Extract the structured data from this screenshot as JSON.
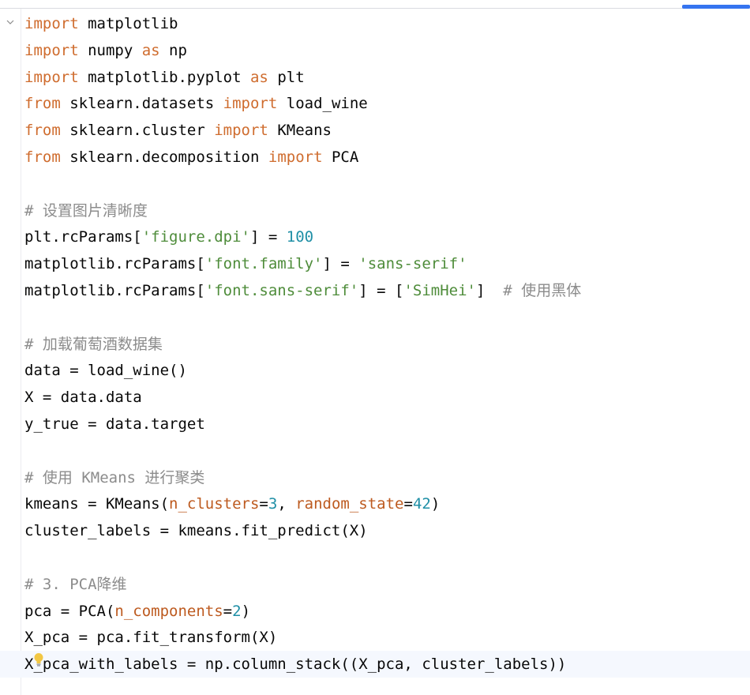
{
  "editor": {
    "lines": [
      [
        {
          "t": "kw",
          "v": "import"
        },
        {
          "t": "id",
          "v": " matplotlib"
        }
      ],
      [
        {
          "t": "kw",
          "v": "import"
        },
        {
          "t": "id",
          "v": " numpy "
        },
        {
          "t": "kw",
          "v": "as"
        },
        {
          "t": "id",
          "v": " np"
        }
      ],
      [
        {
          "t": "kw",
          "v": "import"
        },
        {
          "t": "id",
          "v": " matplotlib.pyplot "
        },
        {
          "t": "kw",
          "v": "as"
        },
        {
          "t": "id",
          "v": " plt"
        }
      ],
      [
        {
          "t": "kw",
          "v": "from"
        },
        {
          "t": "id",
          "v": " sklearn.datasets "
        },
        {
          "t": "kw",
          "v": "import"
        },
        {
          "t": "id",
          "v": " load_wine"
        }
      ],
      [
        {
          "t": "kw",
          "v": "from"
        },
        {
          "t": "id",
          "v": " sklearn.cluster "
        },
        {
          "t": "kw",
          "v": "import"
        },
        {
          "t": "id",
          "v": " KMeans"
        }
      ],
      [
        {
          "t": "kw",
          "v": "from"
        },
        {
          "t": "id",
          "v": " sklearn.decomposition "
        },
        {
          "t": "kw",
          "v": "import"
        },
        {
          "t": "id",
          "v": " PCA"
        }
      ],
      [],
      [
        {
          "t": "cmt",
          "v": "# "
        },
        {
          "t": "cmt-cjk",
          "v": "设置图片清晰度"
        }
      ],
      [
        {
          "t": "id",
          "v": "plt.rcParams["
        },
        {
          "t": "str",
          "v": "'figure.dpi'"
        },
        {
          "t": "id",
          "v": "] = "
        },
        {
          "t": "num",
          "v": "100"
        }
      ],
      [
        {
          "t": "id",
          "v": "matplotlib.rcParams["
        },
        {
          "t": "str",
          "v": "'font.family'"
        },
        {
          "t": "id",
          "v": "] = "
        },
        {
          "t": "str",
          "v": "'sans-serif'"
        }
      ],
      [
        {
          "t": "id",
          "v": "matplotlib.rcParams["
        },
        {
          "t": "str",
          "v": "'font.sans-serif'"
        },
        {
          "t": "id",
          "v": "] = ["
        },
        {
          "t": "str",
          "v": "'SimHei'"
        },
        {
          "t": "id",
          "v": "]  "
        },
        {
          "t": "cmt",
          "v": "# "
        },
        {
          "t": "cmt-cjk",
          "v": "使用黑体"
        }
      ],
      [],
      [
        {
          "t": "cmt",
          "v": "# "
        },
        {
          "t": "cmt-cjk",
          "v": "加载葡萄酒数据集"
        }
      ],
      [
        {
          "t": "id",
          "v": "data = load_wine()"
        }
      ],
      [
        {
          "t": "id",
          "v": "X = data.data"
        }
      ],
      [
        {
          "t": "id",
          "v": "y_true = data.target"
        }
      ],
      [],
      [
        {
          "t": "cmt",
          "v": "# "
        },
        {
          "t": "cmt-cjk",
          "v": "使用"
        },
        {
          "t": "cmt",
          "v": " KMeans "
        },
        {
          "t": "cmt-cjk",
          "v": "进行聚类"
        }
      ],
      [
        {
          "t": "id",
          "v": "kmeans = KMeans("
        },
        {
          "t": "param",
          "v": "n_clusters"
        },
        {
          "t": "id",
          "v": "="
        },
        {
          "t": "num",
          "v": "3"
        },
        {
          "t": "id",
          "v": ", "
        },
        {
          "t": "param",
          "v": "random_state"
        },
        {
          "t": "id",
          "v": "="
        },
        {
          "t": "num",
          "v": "42"
        },
        {
          "t": "id",
          "v": ")"
        }
      ],
      [
        {
          "t": "id",
          "v": "cluster_labels = kmeans.fit_predict(X)"
        }
      ],
      [],
      [
        {
          "t": "cmt",
          "v": "# 3. PCA"
        },
        {
          "t": "cmt-cjk",
          "v": "降维"
        }
      ],
      [
        {
          "t": "id",
          "v": "pca = PCA("
        },
        {
          "t": "param",
          "v": "n_components"
        },
        {
          "t": "id",
          "v": "="
        },
        {
          "t": "num",
          "v": "2"
        },
        {
          "t": "id",
          "v": ")"
        }
      ],
      [
        {
          "t": "id",
          "v": "X_pca = pca.fit_transform(X)"
        }
      ],
      [
        {
          "t": "id",
          "v": "X_pca_with_labels = np.column_stack((X_pca, cluster_labels))"
        }
      ]
    ]
  },
  "icons": {
    "fold": "chevron-down-icon",
    "intention": "lightbulb-icon"
  },
  "colors": {
    "keyword": "#cf6c2e",
    "string": "#4e8c3a",
    "number": "#1f8fa6",
    "parameter": "#bd5a1f",
    "comment": "#8c8c8c",
    "accent": "#3574f0"
  }
}
